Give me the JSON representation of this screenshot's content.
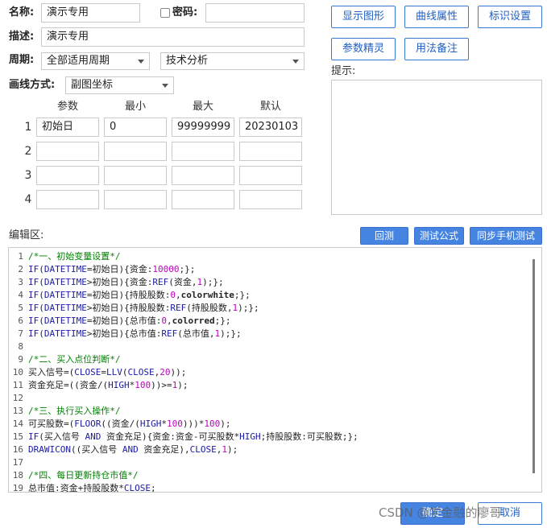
{
  "form": {
    "name_label": "名称:",
    "name_value": "演示专用",
    "password_label": "密码:",
    "password_value": "",
    "desc_label": "描述:",
    "desc_value": "演示专用",
    "period_label": "周期:",
    "period_value": "全部适用周期",
    "category_value": "技术分析",
    "draw_label": "画线方式:",
    "draw_value": "副图坐标"
  },
  "buttons": {
    "show_chart": "显示图形",
    "curve_props": "曲线属性",
    "mark_settings": "标识设置",
    "param_wizard": "参数精灵",
    "usage_notes": "用法备注"
  },
  "hint_label": "提示:",
  "params": {
    "headers": [
      "参数",
      "最小",
      "最大",
      "默认"
    ],
    "rows": [
      {
        "num": "1",
        "name": "初始日",
        "min": "0",
        "max": "99999999",
        "default": "20230103"
      },
      {
        "num": "2",
        "name": "",
        "min": "",
        "max": "",
        "default": ""
      },
      {
        "num": "3",
        "name": "",
        "min": "",
        "max": "",
        "default": ""
      },
      {
        "num": "4",
        "name": "",
        "min": "",
        "max": "",
        "default": ""
      }
    ]
  },
  "editor": {
    "label": "编辑区:",
    "backtest_button": "回测",
    "test_formula_button": "测试公式",
    "sync_mobile_button": "同步手机测试",
    "lines": [
      {
        "n": "1",
        "t": "/*一、初始变量设置*/"
      },
      {
        "n": "2",
        "t": "IF(DATETIME=初始日){资金:10000;};"
      },
      {
        "n": "3",
        "t": "IF(DATETIME>初始日){资金:REF(资金,1);};"
      },
      {
        "n": "4",
        "t": "IF(DATETIME=初始日){持股股数:0,colorwhite;};"
      },
      {
        "n": "5",
        "t": "IF(DATETIME>初始日){持股股数:REF(持股股数,1);};"
      },
      {
        "n": "6",
        "t": "IF(DATETIME=初始日){总市值:0,colorred;};"
      },
      {
        "n": "7",
        "t": "IF(DATETIME>初始日){总市值:REF(总市值,1);};"
      },
      {
        "n": "8",
        "t": ""
      },
      {
        "n": "9",
        "t": "/*二、买入点位判断*/"
      },
      {
        "n": "10",
        "t": "买入信号=(CLOSE=LLV(CLOSE,20));"
      },
      {
        "n": "11",
        "t": "资金充足=((资金/(HIGH*100))>=1);"
      },
      {
        "n": "12",
        "t": ""
      },
      {
        "n": "13",
        "t": "/*三、执行买入操作*/"
      },
      {
        "n": "14",
        "t": "可买股数=(FLOOR((资金/(HIGH*100)))*100);"
      },
      {
        "n": "15",
        "t": "IF(买入信号 AND 资金充足){资金:资金-可买股数*HIGH;持股股数:可买股数;};"
      },
      {
        "n": "16",
        "t": "DRAWICON((买入信号 AND 资金充足),CLOSE,1);"
      },
      {
        "n": "17",
        "t": ""
      },
      {
        "n": "18",
        "t": "/*四、每日更新持仓市值*/"
      },
      {
        "n": "19",
        "t": "总市值:资金+持股股数*CLOSE;"
      }
    ]
  },
  "footer": {
    "ok_button": "确定",
    "cancel_button": "取消",
    "watermark": "CSDN @学金融的廖哥"
  },
  "colors": {
    "accent": "#4684e2",
    "comment": "#008000",
    "keyword": "#1a1aa6",
    "number": "#c000c0"
  }
}
